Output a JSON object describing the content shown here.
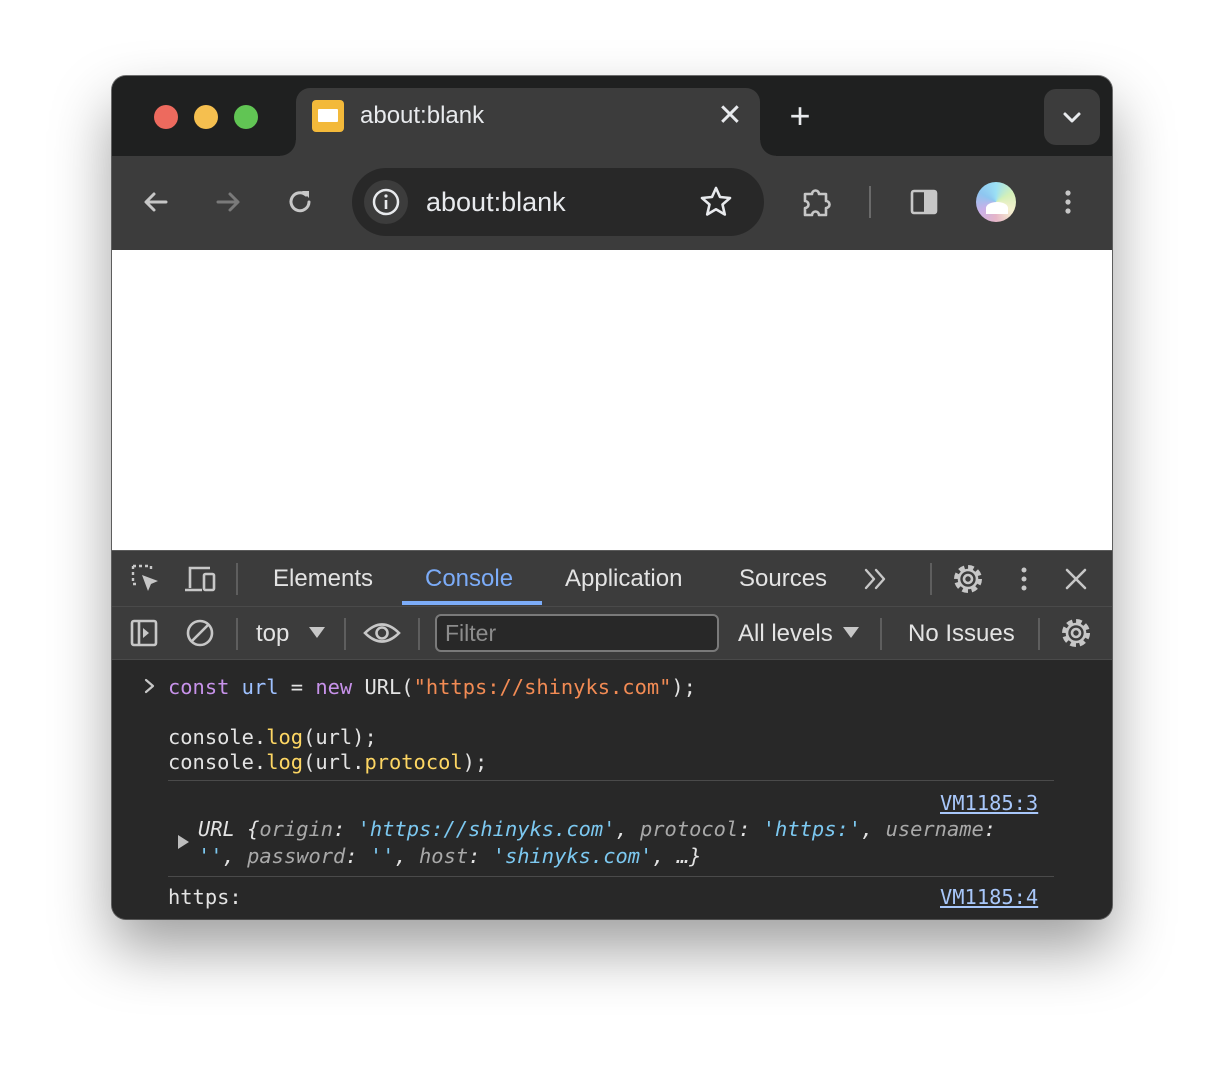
{
  "tab": {
    "title": "about:blank",
    "close_glyph": "✕",
    "new_tab_glyph": "+"
  },
  "omnibox": {
    "url": "about:blank"
  },
  "icons": {
    "back": "arrow-left-icon",
    "forward": "arrow-right-icon",
    "reload": "reload-icon",
    "info": "info-icon",
    "bookmark": "star-icon",
    "extensions": "puzzle-icon",
    "side_panel": "side-panel-icon",
    "menu": "kebab-menu-icon"
  },
  "devtools": {
    "tabs": [
      {
        "label": "Elements"
      },
      {
        "label": "Console"
      },
      {
        "label": "Application"
      },
      {
        "label": "Sources"
      }
    ],
    "more_tabs_glyph": "≫",
    "toolbar": {
      "context": "top",
      "filter_placeholder": "Filter",
      "levels": "All levels",
      "issues": "No Issues"
    }
  },
  "console": {
    "input": {
      "line1": {
        "kw_const": "const",
        "var_url": "url",
        "eq": " = ",
        "kw_new": "new",
        "cls": " URL(",
        "str": "\"https://shinyks.com\"",
        "end": ");"
      },
      "line2": {
        "obj": "console.",
        "fn": "log",
        "rest": "(url);"
      },
      "line3": {
        "obj": "console.",
        "fn": "log",
        "p1": "(url.",
        "prop": "protocol",
        "p2": ");"
      }
    },
    "output": [
      {
        "source": "VM1185:3",
        "head": "URL ",
        "brace_open": "{",
        "k_origin": "origin",
        "v_origin": "'https://shinyks.com'",
        "k_protocol": "protocol",
        "v_protocol": "'https:'",
        "k_username": "username",
        "v_username": "''",
        "k_password": "password",
        "v_password": "''",
        "k_host": "host",
        "v_host": "'shinyks.com'",
        "tail": ", …}"
      },
      {
        "source": "VM1185:4",
        "text": "https:"
      }
    ]
  }
}
